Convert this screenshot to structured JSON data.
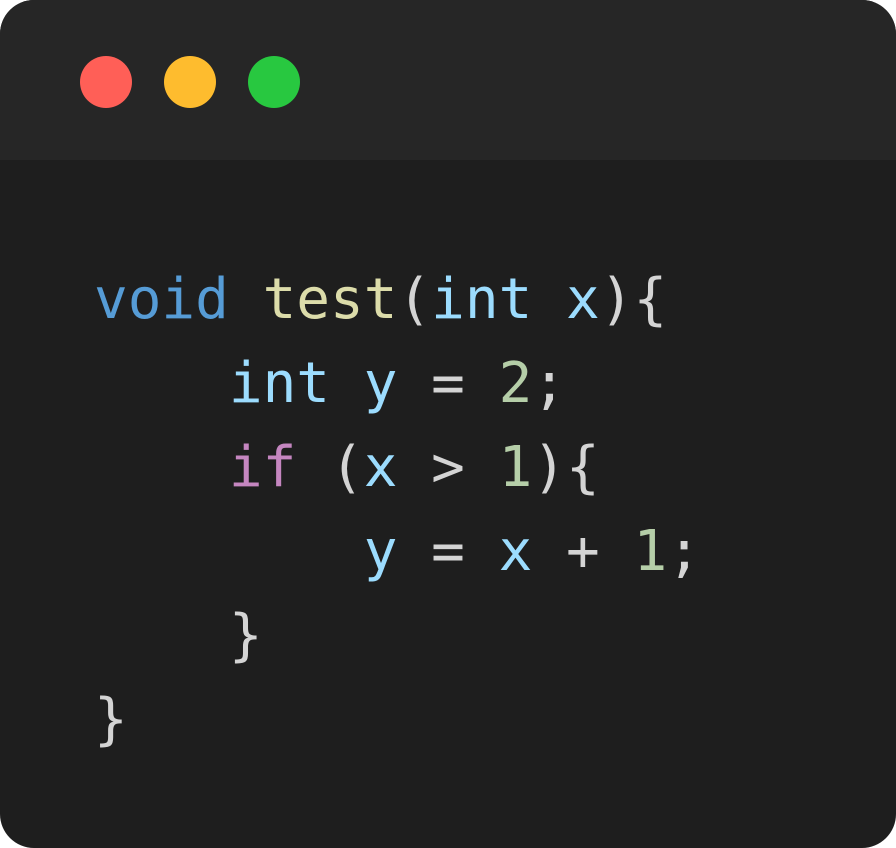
{
  "window": {
    "controls": {
      "close_color": "#ff5f57",
      "minimize_color": "#febc2e",
      "zoom_color": "#28c840"
    }
  },
  "colors": {
    "background": "#1e1e1e",
    "titlebar": "#262626",
    "keyword_type": "#569cd6",
    "function": "#dcdcaa",
    "punctuation": "#d4d4d4",
    "variable": "#9cdcfe",
    "number": "#b5cea8",
    "control": "#c586c0"
  },
  "code": {
    "lines": [
      [
        {
          "text": "void",
          "kind": "keyword_type"
        },
        {
          "text": " ",
          "kind": "punctuation"
        },
        {
          "text": "test",
          "kind": "function"
        },
        {
          "text": "(",
          "kind": "punctuation"
        },
        {
          "text": "int",
          "kind": "variable"
        },
        {
          "text": " ",
          "kind": "punctuation"
        },
        {
          "text": "x",
          "kind": "variable"
        },
        {
          "text": "){",
          "kind": "punctuation"
        }
      ],
      [
        {
          "text": "    ",
          "kind": "punctuation"
        },
        {
          "text": "int",
          "kind": "variable"
        },
        {
          "text": " ",
          "kind": "punctuation"
        },
        {
          "text": "y",
          "kind": "variable"
        },
        {
          "text": " = ",
          "kind": "punctuation"
        },
        {
          "text": "2",
          "kind": "number"
        },
        {
          "text": ";",
          "kind": "punctuation"
        }
      ],
      [
        {
          "text": "    ",
          "kind": "punctuation"
        },
        {
          "text": "if",
          "kind": "control"
        },
        {
          "text": " (",
          "kind": "punctuation"
        },
        {
          "text": "x",
          "kind": "variable"
        },
        {
          "text": " > ",
          "kind": "punctuation"
        },
        {
          "text": "1",
          "kind": "number"
        },
        {
          "text": "){",
          "kind": "punctuation"
        }
      ],
      [
        {
          "text": "        ",
          "kind": "punctuation"
        },
        {
          "text": "y",
          "kind": "variable"
        },
        {
          "text": " = ",
          "kind": "punctuation"
        },
        {
          "text": "x",
          "kind": "variable"
        },
        {
          "text": " + ",
          "kind": "punctuation"
        },
        {
          "text": "1",
          "kind": "number"
        },
        {
          "text": ";",
          "kind": "punctuation"
        }
      ],
      [
        {
          "text": "    ",
          "kind": "punctuation"
        },
        {
          "text": "}",
          "kind": "punctuation"
        }
      ],
      [
        {
          "text": "}",
          "kind": "punctuation"
        }
      ]
    ]
  }
}
